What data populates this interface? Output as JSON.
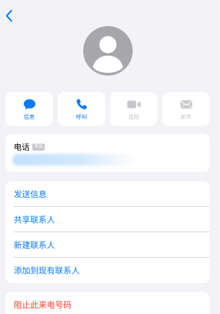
{
  "nav": {
    "back_icon": "chevron-left-icon"
  },
  "avatar": {
    "icon": "person-silhouette-icon"
  },
  "actions": [
    {
      "label": "信息",
      "icon": "message-icon",
      "enabled": true
    },
    {
      "label": "呼叫",
      "icon": "phone-icon",
      "enabled": true
    },
    {
      "label": "视频",
      "icon": "video-icon",
      "enabled": false
    },
    {
      "label": "邮件",
      "icon": "mail-icon",
      "enabled": false
    }
  ],
  "phone": {
    "label": "电话",
    "badge": "首选"
  },
  "menu": {
    "items": [
      {
        "label": "发送信息"
      },
      {
        "label": "共享联系人"
      },
      {
        "label": "新建联系人"
      },
      {
        "label": "添加到现有联系人"
      }
    ]
  },
  "block": {
    "label": "阻止此来电号码"
  },
  "colors": {
    "accent": "#0a7aff",
    "danger": "#ff3b30",
    "background": "#f2f2f7",
    "disabled": "#c7c7cc"
  }
}
